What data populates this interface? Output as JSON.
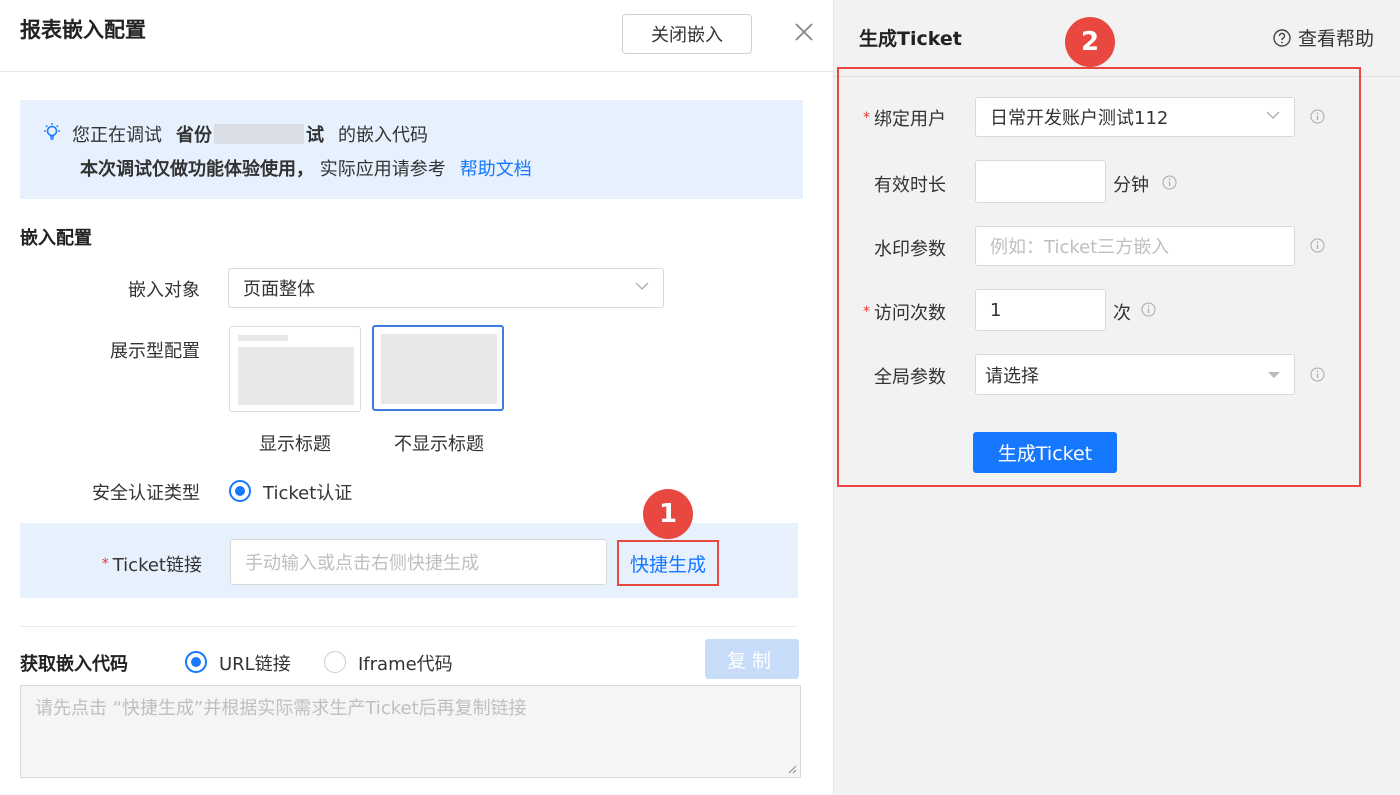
{
  "dialog": {
    "title": "报表嵌入配置",
    "close_embed_label": "关闭嵌入"
  },
  "tip": {
    "line1_prefix": "您正在调试",
    "line1_name_start": "省份",
    "line1_name_end": "试",
    "line1_suffix": "的嵌入代码",
    "line2_bold": "本次调试仅做功能体验使用，",
    "line2_text": "实际应用请参考",
    "line2_link": "帮助文档"
  },
  "embed_config": {
    "section_title": "嵌入配置",
    "target_label": "嵌入对象",
    "target_value": "页面整体",
    "display_label": "展示型配置",
    "display_options": [
      "显示标题",
      "不显示标题"
    ],
    "display_selected": "不显示标题",
    "auth_label": "安全认证类型",
    "auth_option": "Ticket认证",
    "ticket_label": "Ticket链接",
    "ticket_placeholder": "手动输入或点击右侧快捷生成",
    "quick_generate": "快捷生成"
  },
  "get_code": {
    "section_title": "获取嵌入代码",
    "options": [
      "URL链接",
      "Iframe代码"
    ],
    "selected": "URL链接",
    "copy_label": "复制",
    "placeholder": "请先点击 “快捷生成”并根据实际需求生产Ticket后再复制链接"
  },
  "ticket_panel": {
    "title": "生成Ticket",
    "help": "查看帮助",
    "bind_user_label": "绑定用户",
    "bind_user_value": "日常开发账户测试112",
    "duration_label": "有效时长",
    "duration_value": "",
    "duration_unit": "分钟",
    "watermark_label": "水印参数",
    "watermark_placeholder": "例如：Ticket三方嵌入",
    "visits_label": "访问次数",
    "visits_value": "1",
    "visits_unit": "次",
    "global_label": "全局参数",
    "global_placeholder": "请选择",
    "generate_label": "生成Ticket"
  },
  "annotations": {
    "badge1": "1",
    "badge2": "2"
  },
  "colors": {
    "primary": "#1677ff",
    "highlight_red": "#e8483f",
    "tip_bg": "#e7f0fd"
  }
}
